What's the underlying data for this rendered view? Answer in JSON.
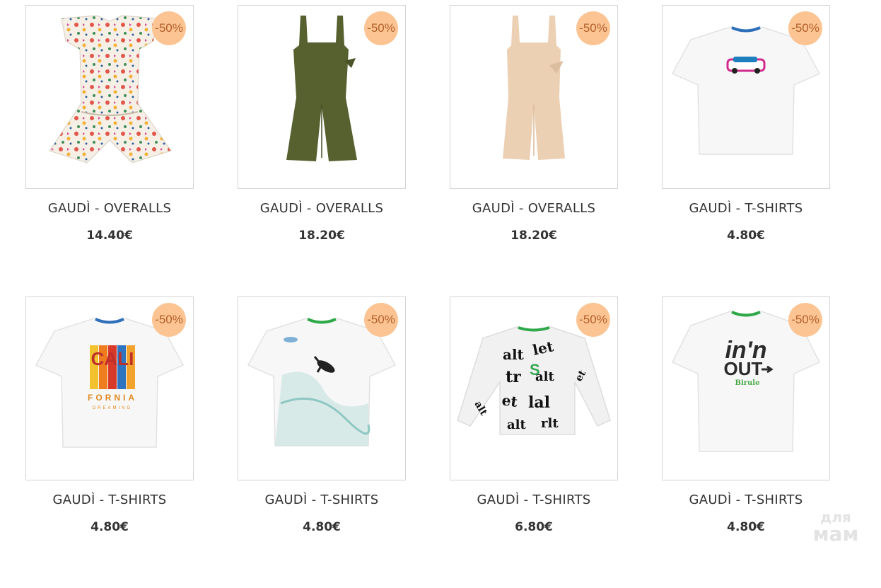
{
  "products": [
    {
      "title": "GAUDÌ - OVERALLS",
      "price": "14.40€",
      "discount": "-50%",
      "image": "floral-romper"
    },
    {
      "title": "GAUDÌ - OVERALLS",
      "price": "18.20€",
      "discount": "-50%",
      "image": "olive-jumpsuit"
    },
    {
      "title": "GAUDÌ - OVERALLS",
      "price": "18.20€",
      "discount": "-50%",
      "image": "beige-jumpsuit"
    },
    {
      "title": "GAUDÌ - T-SHIRTS",
      "price": "4.80€",
      "discount": "-50%",
      "image": "car-tshirt"
    },
    {
      "title": "GAUDÌ - T-SHIRTS",
      "price": "4.80€",
      "discount": "-50%",
      "image": "california-tshirt"
    },
    {
      "title": "GAUDÌ - T-SHIRTS",
      "price": "4.80€",
      "discount": "-50%",
      "image": "surfer-tshirt"
    },
    {
      "title": "GAUDÌ - T-SHIRTS",
      "price": "6.80€",
      "discount": "-50%",
      "image": "letters-sweatshirt"
    },
    {
      "title": "GAUDÌ - T-SHIRTS",
      "price": "4.80€",
      "discount": "-50%",
      "image": "in-n-out-tshirt"
    }
  ],
  "prints": {
    "cali": "CALI",
    "fornia": "FORNIA",
    "dreaming": "DREAMING",
    "in_n": "in'n",
    "out": "OUT",
    "birule": "Birule"
  },
  "watermark": {
    "line1": "для",
    "line2": "мам"
  },
  "colors": {
    "badge_bg": "#fbc492",
    "badge_text": "#b4602b",
    "olive": "#57602f",
    "beige": "#ecd0b4"
  }
}
